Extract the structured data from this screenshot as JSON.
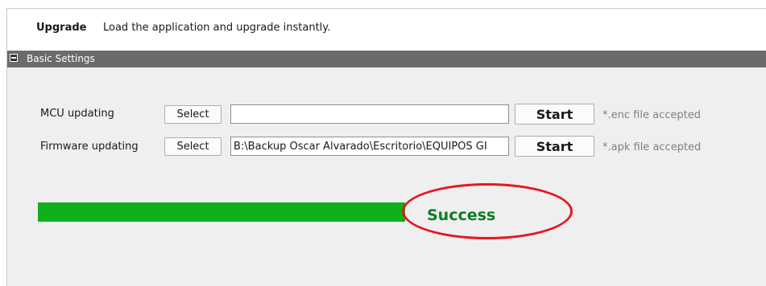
{
  "header": {
    "title": "Upgrade",
    "description": "Load the application and upgrade instantly."
  },
  "section": {
    "label": "Basic Settings",
    "icon": "collapse-icon"
  },
  "rows": [
    {
      "label": "MCU updating",
      "select_label": "Select",
      "file_path": "",
      "start_label": "Start",
      "hint": "*.enc file accepted"
    },
    {
      "label": "Firmware updating",
      "select_label": "Select",
      "file_path": "B:\\Backup Oscar Alvarado\\Escritorio\\EQUIPOS GI",
      "start_label": "Start",
      "hint": "*.apk file accepted"
    }
  ],
  "progress": {
    "percent": 100,
    "status": "Success",
    "bar_color": "#0eb11c",
    "status_color": "#0b7d22",
    "highlight_color": "#e8161e"
  }
}
